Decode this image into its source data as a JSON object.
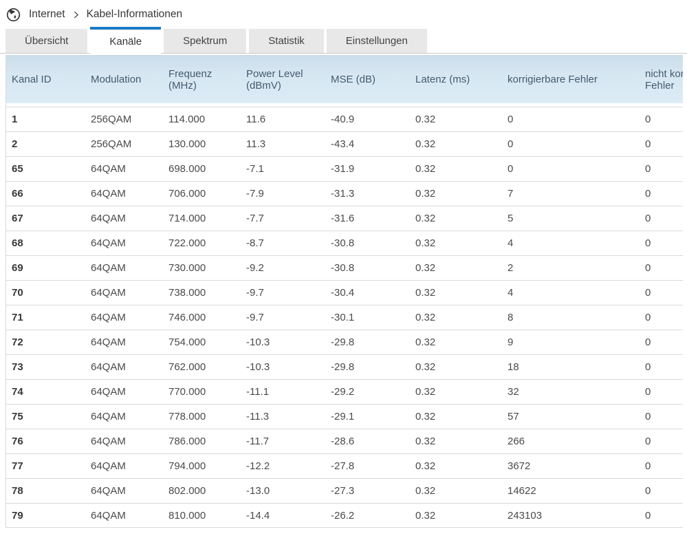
{
  "breadcrumb": {
    "icon": "globe-icon",
    "items": [
      "Internet",
      "Kabel-Informationen"
    ],
    "separator": ">"
  },
  "tabs": [
    {
      "label": "Übersicht",
      "active": false
    },
    {
      "label": "Kanäle",
      "active": true
    },
    {
      "label": "Spektrum",
      "active": false
    },
    {
      "label": "Statistik",
      "active": false
    },
    {
      "label": "Einstellungen",
      "active": false
    }
  ],
  "colors": {
    "accent_blue": "#1779c4",
    "table_header_bg": "#d7e7f2",
    "tab_inactive_bg": "#e8e8e8",
    "row_border": "#d9d9d9"
  },
  "table": {
    "columns": [
      "Kanal ID",
      "Modulation",
      "Frequenz (MHz)",
      "Power Level (dBmV)",
      "MSE (dB)",
      "Latenz (ms)",
      "korrigierbare Fehler",
      "nicht korrigierbare Fehler"
    ],
    "rows": [
      [
        "1",
        "256QAM",
        "114.000",
        "11.6",
        "-40.9",
        "0.32",
        "0",
        "0"
      ],
      [
        "2",
        "256QAM",
        "130.000",
        "11.3",
        "-43.4",
        "0.32",
        "0",
        "0"
      ],
      [
        "65",
        "64QAM",
        "698.000",
        "-7.1",
        "-31.9",
        "0.32",
        "0",
        "0"
      ],
      [
        "66",
        "64QAM",
        "706.000",
        "-7.9",
        "-31.3",
        "0.32",
        "7",
        "0"
      ],
      [
        "67",
        "64QAM",
        "714.000",
        "-7.7",
        "-31.6",
        "0.32",
        "5",
        "0"
      ],
      [
        "68",
        "64QAM",
        "722.000",
        "-8.7",
        "-30.8",
        "0.32",
        "4",
        "0"
      ],
      [
        "69",
        "64QAM",
        "730.000",
        "-9.2",
        "-30.8",
        "0.32",
        "2",
        "0"
      ],
      [
        "70",
        "64QAM",
        "738.000",
        "-9.7",
        "-30.4",
        "0.32",
        "4",
        "0"
      ],
      [
        "71",
        "64QAM",
        "746.000",
        "-9.7",
        "-30.1",
        "0.32",
        "8",
        "0"
      ],
      [
        "72",
        "64QAM",
        "754.000",
        "-10.3",
        "-29.8",
        "0.32",
        "9",
        "0"
      ],
      [
        "73",
        "64QAM",
        "762.000",
        "-10.3",
        "-29.8",
        "0.32",
        "18",
        "0"
      ],
      [
        "74",
        "64QAM",
        "770.000",
        "-11.1",
        "-29.2",
        "0.32",
        "32",
        "0"
      ],
      [
        "75",
        "64QAM",
        "778.000",
        "-11.3",
        "-29.1",
        "0.32",
        "57",
        "0"
      ],
      [
        "76",
        "64QAM",
        "786.000",
        "-11.7",
        "-28.6",
        "0.32",
        "266",
        "0"
      ],
      [
        "77",
        "64QAM",
        "794.000",
        "-12.2",
        "-27.8",
        "0.32",
        "3672",
        "0"
      ],
      [
        "78",
        "64QAM",
        "802.000",
        "-13.0",
        "-27.3",
        "0.32",
        "14622",
        "0"
      ],
      [
        "79",
        "64QAM",
        "810.000",
        "-14.4",
        "-26.2",
        "0.32",
        "243103",
        "0"
      ]
    ]
  }
}
